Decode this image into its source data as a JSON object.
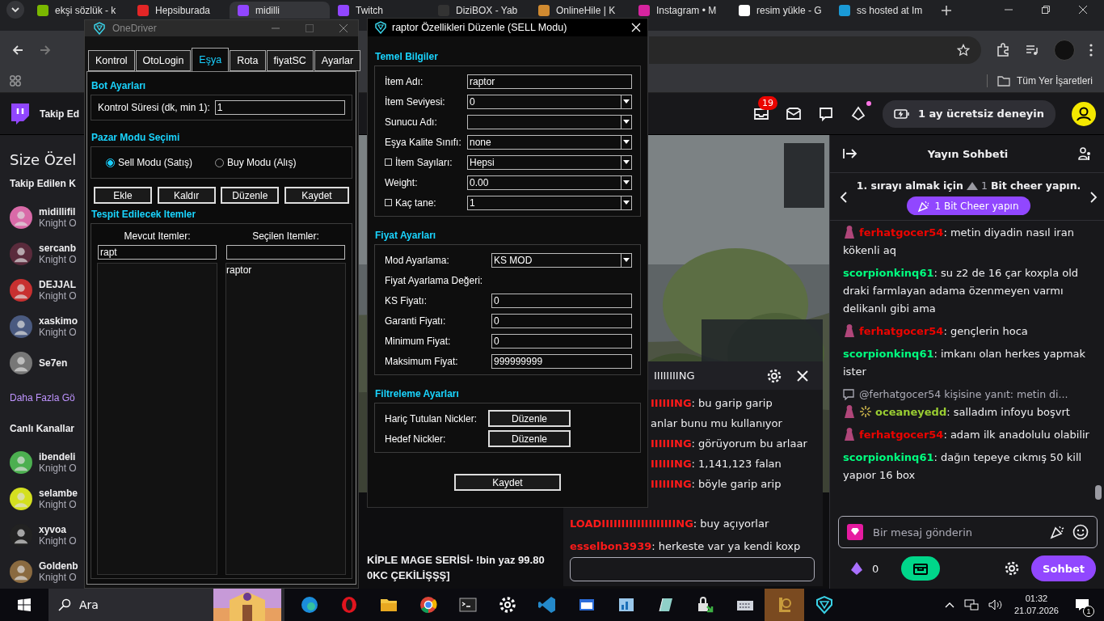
{
  "browser": {
    "tabs": [
      {
        "title": "ekşi sözlük - k",
        "selected": false
      },
      {
        "title": "Hepsiburada",
        "selected": false
      },
      {
        "title": "midilli",
        "selected": true
      },
      {
        "title": "Twitch",
        "selected": false
      },
      {
        "title": "DiziBOX - Yab",
        "selected": false
      },
      {
        "title": "OnlineHile | K",
        "selected": false
      },
      {
        "title": "Instagram • M",
        "selected": false
      },
      {
        "title": "resim yükle - G",
        "selected": false
      },
      {
        "title": "ss hosted at Im",
        "selected": false
      }
    ],
    "bookmarks": {
      "label": "Tüm Yer İşaretleri"
    }
  },
  "twitch": {
    "header": {
      "following_link": "Takip Ed",
      "notification_count": "19",
      "trial_button": "1 ay ücretsiz deneyin"
    },
    "sidebar": {
      "title": "Size Özel",
      "sections": [
        {
          "heading": "Takip Edilen K",
          "more": "Daha Fazla Gö",
          "channels": [
            {
              "name": "midillifil",
              "game": "Knight O"
            },
            {
              "name": "sercanb",
              "game": "Knight O"
            },
            {
              "name": "DEJJAL",
              "game": "Knight O"
            },
            {
              "name": "xaskimo",
              "game": "Knight O"
            },
            {
              "name": "Se7en"
            }
          ]
        },
        {
          "heading": "Canlı Kanallar",
          "channels": [
            {
              "name": "ibendeli",
              "game": "Knight O"
            },
            {
              "name": "selambe",
              "game": "Knight O"
            },
            {
              "name": "xyvoa",
              "game": "Knight O"
            },
            {
              "name": "Goldenb",
              "game": "Knight O"
            }
          ]
        }
      ]
    },
    "stream": {
      "title_lines": [
        "KİPLE MAGE SERİSİ- !bin yaz 99.80",
        "0KC ÇEKİLİŞŞŞ]"
      ]
    },
    "overlay_chat": {
      "title": "IIIIIIIING",
      "lines": [
        {
          "kind": "cut",
          "user": "IIIIIING",
          "color": "#ff1a1a",
          "text": ": bu garip garip"
        },
        {
          "kind": "cut",
          "text": "anlar bunu mu kullanıyor"
        },
        {
          "kind": "cut",
          "user": "IIIIIING",
          "color": "#ff1a1a",
          "text": ": görüyorum bu arlaar"
        },
        {
          "kind": "cut",
          "user": "IIIIIING",
          "color": "#ff1a1a",
          "text": ": 1,141,123 falan"
        },
        {
          "kind": "cut",
          "user": "IIIIIING",
          "color": "#ff1a1a",
          "text": ": böyle garip arip"
        },
        {
          "kind": "full",
          "user": "LOADIIIIIIIIIIIIIIIIIIING",
          "color": "#ff1a1a",
          "text": ": buy açıyorlar"
        },
        {
          "kind": "full",
          "user": "esselbon3939",
          "color": "#ff1a1a",
          "text": ": herkeste var ya kendi koxp"
        }
      ]
    },
    "chat": {
      "title": "Yayın Sohbeti",
      "cheer": {
        "prompt_start": "1. sırayı almak için",
        "amount": "1",
        "prompt_end": "Bit cheer yapın.",
        "button": "1 Bit Cheer yapın"
      },
      "messages": [
        {
          "kind": "message",
          "figure_badge": true,
          "sparkle_badge": false,
          "user": "ferhatgocer54",
          "color": "#eb0400",
          "text": ": metin diyadin nasıl iran kökenli aq"
        },
        {
          "kind": "message",
          "figure_badge": false,
          "sparkle_badge": false,
          "user": "scorpionkinq61",
          "color": "#00ff7f",
          "text": ": su z2 de 16 çar koxpla old draki farmlayan adama özenmeyen varmı delikanlı gibi ama"
        },
        {
          "kind": "message",
          "figure_badge": true,
          "sparkle_badge": false,
          "user": "ferhatgocer54",
          "color": "#eb0400",
          "text": ": gençlerin hoca"
        },
        {
          "kind": "message",
          "figure_badge": false,
          "sparkle_badge": false,
          "user": "scorpionkinq61",
          "color": "#00ff7f",
          "text": ": imkanı olan herkes yapmak ister"
        },
        {
          "kind": "reply",
          "text": "@ferhatgocer54 kişisine yanıt: metin di..."
        },
        {
          "kind": "message",
          "figure_badge": true,
          "sparkle_badge": true,
          "user": "oceaneyedd",
          "color": "#9acd32",
          "text": ": salladım infoyu boşvrt"
        },
        {
          "kind": "message",
          "figure_badge": true,
          "sparkle_badge": false,
          "user": "ferhatgocer54",
          "color": "#eb0400",
          "text": ": adam ilk anadolulu olabilir"
        },
        {
          "kind": "message",
          "figure_badge": false,
          "sparkle_badge": false,
          "user": "scorpionkinq61",
          "color": "#00ff7f",
          "text": ": dağın tepeye cıkmış 50 kill yapıor 16 box"
        }
      ],
      "input": {
        "placeholder": "Bir mesaj gönderin"
      },
      "bits_count": "0",
      "send_button": "Sohbet"
    }
  },
  "tool": {
    "title": "OneDriver",
    "tabs": [
      {
        "label": "Kontrol",
        "selected": false
      },
      {
        "label": "OtoLogin",
        "selected": false
      },
      {
        "label": "Eşya",
        "selected": true
      },
      {
        "label": "Rota",
        "selected": false
      },
      {
        "label": "fiyatSC",
        "selected": false
      },
      {
        "label": "Ayarlar",
        "selected": false
      }
    ],
    "bot": {
      "heading": "Bot Ayarları",
      "label": "Kontrol Süresi (dk, min 1):",
      "value": "1"
    },
    "market": {
      "heading": "Pazar Modu Seçimi",
      "options": [
        {
          "label": "Sell Modu (Satış)",
          "checked": true
        },
        {
          "label": "Buy Modu (Alış)",
          "checked": false
        }
      ]
    },
    "buttons": [
      "Ekle",
      "Kaldır",
      "Düzenle",
      "Kaydet"
    ],
    "items": {
      "heading": "Tespit Edilecek Itemler",
      "columns": [
        {
          "label": "Mevcut Itemler:",
          "filter": "rapt"
        },
        {
          "label": "Seçilen Itemler:",
          "items": [
            {
              "name": "raptor",
              "selected": false
            }
          ]
        }
      ]
    }
  },
  "dialog": {
    "title": "raptor Özellikleri Düzenle (SELL Modu)",
    "sections": [
      {
        "heading": "Temel Bilgiler",
        "rows": [
          {
            "kind": "text",
            "label": "İtem Adı:",
            "value": "raptor"
          },
          {
            "kind": "combo",
            "label": "İtem Seviyesi:",
            "value": "0"
          },
          {
            "kind": "combo",
            "label": "Sunucu Adı:"
          },
          {
            "kind": "combo",
            "label": "Eşya Kalite Sınıfı:",
            "value": "none"
          },
          {
            "kind": "combo",
            "label": "İtem Sayıları:",
            "value": "Hepsi",
            "checked": false
          },
          {
            "kind": "combo",
            "label": "Weight:",
            "value": "0.00"
          },
          {
            "kind": "combo",
            "label": "Kaç tane:",
            "value": "1",
            "checked": false
          }
        ]
      },
      {
        "heading": "Fiyat Ayarları",
        "rows": [
          {
            "kind": "combo",
            "label": "Mod Ayarlama:",
            "value": "KS MOD"
          },
          {
            "kind": "label",
            "label": "Fiyat Ayarlama Değeri:"
          },
          {
            "kind": "text",
            "label": "KS Fiyatı:",
            "value": "0"
          },
          {
            "kind": "text",
            "label": "Garanti Fiyatı:",
            "value": "0"
          },
          {
            "kind": "text",
            "label": "Minimum Fiyat:",
            "value": "0"
          },
          {
            "kind": "text",
            "label": "Maksimum Fiyat:",
            "value": "999999999"
          }
        ]
      },
      {
        "heading": "Filtreleme Ayarları",
        "rows": [
          {
            "kind": "button",
            "label": "Hariç Tutulan Nickler:",
            "value": "Düzenle"
          },
          {
            "kind": "button",
            "label": "Hedef Nickler:",
            "value": "Düzenle"
          }
        ]
      }
    ],
    "save_button": "Kaydet"
  },
  "taskbar": {
    "search": "Ara",
    "apps": [
      {
        "kind": "edge",
        "selected": false
      },
      {
        "kind": "opera",
        "selected": false
      },
      {
        "kind": "folder",
        "selected": false
      },
      {
        "kind": "chrome",
        "selected": false
      },
      {
        "kind": "terminal",
        "selected": false
      },
      {
        "kind": "gear",
        "selected": false
      },
      {
        "kind": "code",
        "selected": false
      },
      {
        "kind": "window",
        "selected": false
      },
      {
        "kind": "chart",
        "selected": false
      },
      {
        "kind": "pen",
        "selected": false
      },
      {
        "kind": "lock",
        "selected": false
      },
      {
        "kind": "keyboard",
        "selected": false
      },
      {
        "kind": "game",
        "selected": true
      },
      {
        "kind": "logo",
        "selected": false
      }
    ],
    "time": "01:32",
    "date": "21.07.2026",
    "notifications": "1"
  }
}
